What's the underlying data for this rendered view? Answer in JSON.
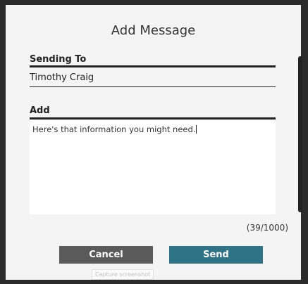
{
  "dialog": {
    "title": "Add Message",
    "sending_to_label": "Sending To",
    "recipient": "Timothy Craig",
    "add_label": "Add",
    "message": "Here's that information you might need.",
    "char_count": "(39/1000)",
    "cancel_label": "Cancel",
    "send_label": "Send"
  },
  "tooltip": "Capture screenshot",
  "colors": {
    "send_button": "#2e7486",
    "cancel_button": "#5a5a5a",
    "frame": "#2a2a2a"
  }
}
